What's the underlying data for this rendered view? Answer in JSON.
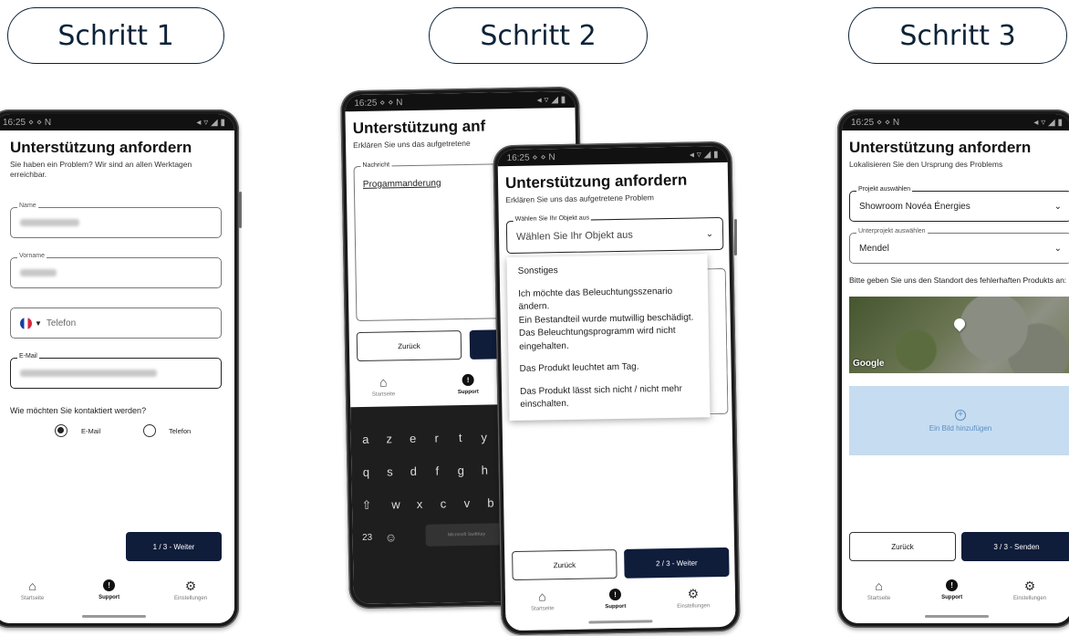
{
  "steps": [
    {
      "label": "Schritt 1"
    },
    {
      "label": "Schritt 2"
    },
    {
      "label": "Schritt 3"
    }
  ],
  "phone1": {
    "status_time": "16:25",
    "status_icons_left": "⋄ ⋄ N",
    "status_icons_right": "◂ ▿ ◢ ▮",
    "title": "Unterstützung anfordern",
    "subtitle": "Sie haben ein Problem? Wir sind an allen Werktagen erreichbar.",
    "name_label": "Name",
    "vorname_label": "Vorname",
    "telefon_placeholder": "Telefon",
    "email_label": "E-Mail",
    "contact_question": "Wie möchten Sie kontaktiert werden?",
    "opt_email": "E-Mail",
    "opt_phone": "Telefon",
    "next_button": "1 / 3 - Weiter"
  },
  "phone2back": {
    "status_time": "16:25",
    "status_icons_left": "⋄ ⋄ N",
    "status_icons_right": "◂ ▿ ◢ ▮",
    "title": "Unterstützung anf",
    "subtitle": "Erklären Sie uns das aufgetretene",
    "message_label": "Nachricht",
    "message_text": "Progammanderung",
    "back_button": "Zurück",
    "nav_home": "Startseite",
    "nav_support": "Support",
    "keyboard_row1": [
      "a",
      "z",
      "e",
      "r",
      "t",
      "y"
    ],
    "keyboard_row2": [
      "q",
      "s",
      "d",
      "f",
      "g",
      "h"
    ],
    "keyboard_row3": [
      "w",
      "x",
      "c",
      "v",
      "b"
    ],
    "key_123": "23",
    "space_label": "Microsoft SwiftKey"
  },
  "phone2front": {
    "status_time": "16:25",
    "status_icons_left": "⋄ ⋄ N",
    "status_icons_right": "◂ ▿ ◢ ▮",
    "title": "Unterstützung anfordern",
    "subtitle": "Erklären Sie uns das aufgetretene Problem",
    "select_label": "Wählen Sie Ihr Objekt aus",
    "select_placeholder": "Wählen Sie Ihr Objekt aus",
    "options": [
      "Sonstiges",
      "Ich möchte das Beleuchtungsszenario ändern.",
      "Ein Bestandteil wurde mutwillig beschädigt.",
      "Das Beleuchtungsprogramm wird nicht eingehalten.",
      "Das Produkt leuchtet am Tag.",
      "Das Produkt lässt sich nicht / nicht mehr einschalten."
    ],
    "back_button": "Zurück",
    "next_button": "2 / 3 - Weiter"
  },
  "phone3": {
    "status_time": "16:25",
    "status_icons_left": "⋄ ⋄ N",
    "status_icons_right": "◂ ▿ ◢ ▮",
    "title": "Unterstützung anfordern",
    "subtitle": "Lokalisieren Sie den Ursprung des Problems",
    "project_label": "Projekt auswählen",
    "project_value": "Showroom Novéa Énergies",
    "subproject_label": "Unterprojekt auswählen",
    "subproject_value": "Mendel",
    "location_prompt": "Bitte geben Sie uns den Standort des fehlerhaften Produkts an:",
    "map_brand": "Google",
    "add_image": "Ein Bild hinzufügen",
    "back_button": "Zurück",
    "send_button": "3 / 3 - Senden"
  },
  "nav": {
    "home": "Startseite",
    "support": "Support",
    "settings": "Einstellungen"
  },
  "colors": {
    "primary": "#0f1c3a",
    "outline": "#0d2338",
    "upload_bg": "#c6dcf0",
    "upload_text": "#5b8fc4"
  }
}
